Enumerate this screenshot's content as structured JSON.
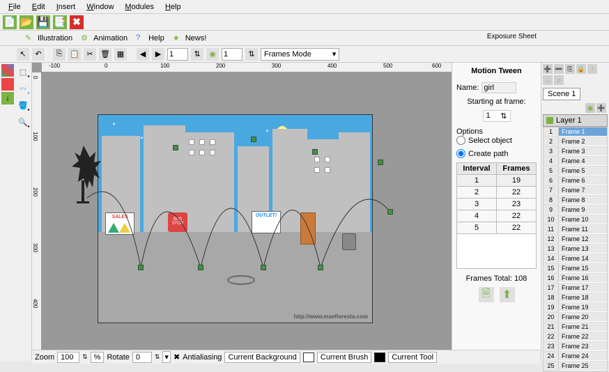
{
  "menu": {
    "file": "File",
    "edit": "Edit",
    "insert": "Insert",
    "window": "Window",
    "modules": "Modules",
    "help": "Help"
  },
  "tabs": {
    "illustration": "Illustration",
    "animation": "Animation",
    "help": "Help",
    "news": "News!"
  },
  "toolbar2": {
    "frame1": "1",
    "frame2": "1",
    "mode": "Frames Mode"
  },
  "exposure_title": "Exposure Sheet",
  "canvas": {
    "watermark": "http://www.maefloresta.com",
    "sign1": "SALES",
    "sign2": "BUS STOP",
    "sign3": "OUTLET!"
  },
  "ruler_h": [
    "-100",
    "0",
    "100",
    "200",
    "300",
    "400",
    "500",
    "600"
  ],
  "ruler_v": [
    "0",
    "100",
    "200",
    "300",
    "400"
  ],
  "props": {
    "title": "Motion Tween",
    "name_lbl": "Name:",
    "name_val": "girl",
    "starting_lbl": "Starting at frame:",
    "starting_val": "1",
    "options_lbl": "Options",
    "opt1": "Select object",
    "opt2": "Create path",
    "th1": "Interval",
    "th2": "Frames",
    "rows": [
      {
        "i": "1",
        "f": "19"
      },
      {
        "i": "2",
        "f": "22"
      },
      {
        "i": "3",
        "f": "23"
      },
      {
        "i": "4",
        "f": "22"
      },
      {
        "i": "5",
        "f": "22"
      }
    ],
    "total": "Frames Total: 108"
  },
  "scene": "Scene 1",
  "layer": "Layer 1",
  "frames": [
    "Frame 1",
    "Frame 2",
    "Frame 3",
    "Frame 4",
    "Frame 5",
    "Frame 6",
    "Frame 7",
    "Frame 8",
    "Frame 9",
    "Frame 10",
    "Frame 11",
    "Frame 12",
    "Frame 13",
    "Frame 14",
    "Frame 15",
    "Frame 16",
    "Frame 17",
    "Frame 18",
    "Frame 19",
    "Frame 20",
    "Frame 21",
    "Frame 22",
    "Frame 23",
    "Frame 24",
    "Frame 25"
  ],
  "status": {
    "zoom_lbl": "Zoom",
    "zoom_val": "100",
    "zoom_unit": "%",
    "rotate_lbl": "Rotate",
    "rotate_val": "0",
    "aa": "Antialiasing",
    "bg": "Current Background",
    "brush": "Current Brush",
    "tool": "Current Tool"
  }
}
